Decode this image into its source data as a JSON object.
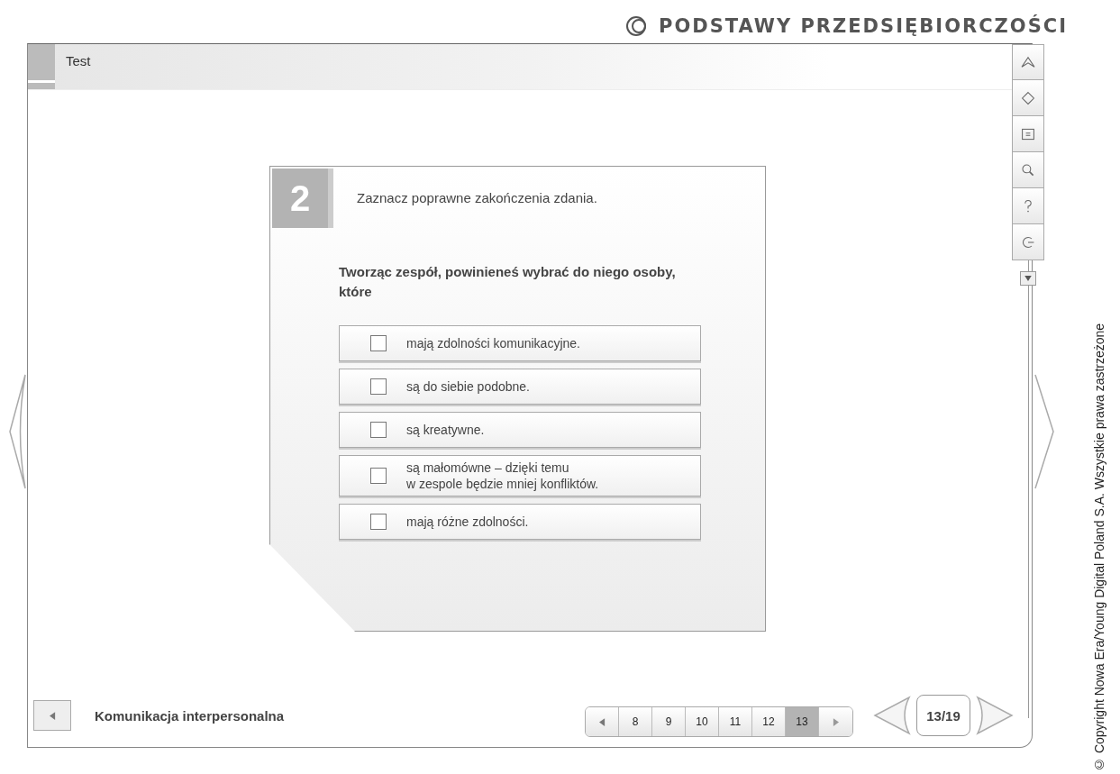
{
  "header": {
    "title": "PODSTAWY PRZEDSIĘBIORCZOŚCI"
  },
  "section_title": "Test",
  "question": {
    "number": "2",
    "instruction": "Zaznacz poprawne zakończenia zdania.",
    "prompt": "Tworząc zespół, powinieneś wybrać do niego osoby, które",
    "options": [
      {
        "text": "mają zdolności komunikacyjne.",
        "checked": false
      },
      {
        "text": "są do siebie podobne.",
        "checked": false
      },
      {
        "text": "są kreatywne.",
        "checked": false
      },
      {
        "text": "są małomówne – dzięki temu\nw zespole będzie mniej konfliktów.",
        "checked": false
      },
      {
        "text": "mają różne zdolności.",
        "checked": false
      }
    ]
  },
  "footer": {
    "chapter": "Komunikacja interpersonalna",
    "pages": [
      {
        "label": "8",
        "selected": false
      },
      {
        "label": "9",
        "selected": false
      },
      {
        "label": "10",
        "selected": false
      },
      {
        "label": "11",
        "selected": false
      },
      {
        "label": "12",
        "selected": false
      },
      {
        "label": "13",
        "selected": true
      }
    ],
    "counter": "13/19"
  },
  "copyright": "© Copyright Nowa Era/Young Digital Poland S.A. Wszystkie prawa zastrzeżone"
}
